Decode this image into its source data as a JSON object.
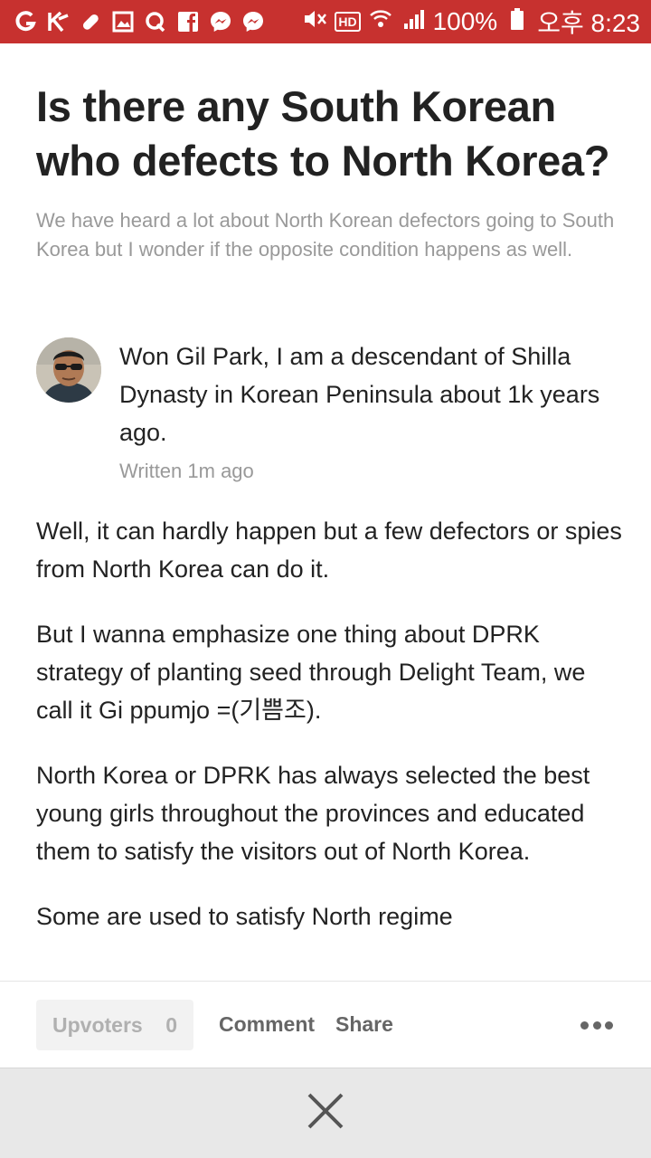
{
  "status_bar": {
    "left_icons": [
      "g-icon",
      "k-icon",
      "pill-icon",
      "image-icon",
      "q-icon",
      "facebook-icon",
      "messenger-icon",
      "messenger-icon"
    ],
    "hd_label": "HD",
    "battery_text": "100%",
    "time_text": "오후 8:23"
  },
  "question": {
    "title": "Is there any South Korean who defects to North Korea?",
    "details": "We have heard a lot about North Korean defectors going to South Korea but I wonder if the opposite condition happens as well."
  },
  "answer": {
    "author_credential": "Won Gil Park, I am a descendant of Shilla Dynasty in Korean Peninsula about 1k years ago.",
    "written_time": "Written 1m ago",
    "paragraphs": [
      "Well, it can hardly happen but a few defectors or spies from North Korea can do it.",
      "But I wanna emphasize one thing about DPRK strategy of planting seed through Delight Team, we call it Gi ppumjo =(기쁨조).",
      "North Korea or DPRK has always selected the best young girls throughout the provinces and educated them to satisfy the visitors out of North Korea.",
      "Some are used to satisfy North regime"
    ]
  },
  "actions": {
    "upvoters_label": "Upvoters",
    "upvoters_count": "0",
    "comment_label": "Comment",
    "share_label": "Share",
    "more_icon": "more-dots-icon"
  },
  "close_icon": "close-icon",
  "colors": {
    "status_bar": "#c7312f",
    "text": "#222222",
    "muted": "#999999",
    "action_text": "#666666",
    "close_bar": "#e8e8e8"
  }
}
